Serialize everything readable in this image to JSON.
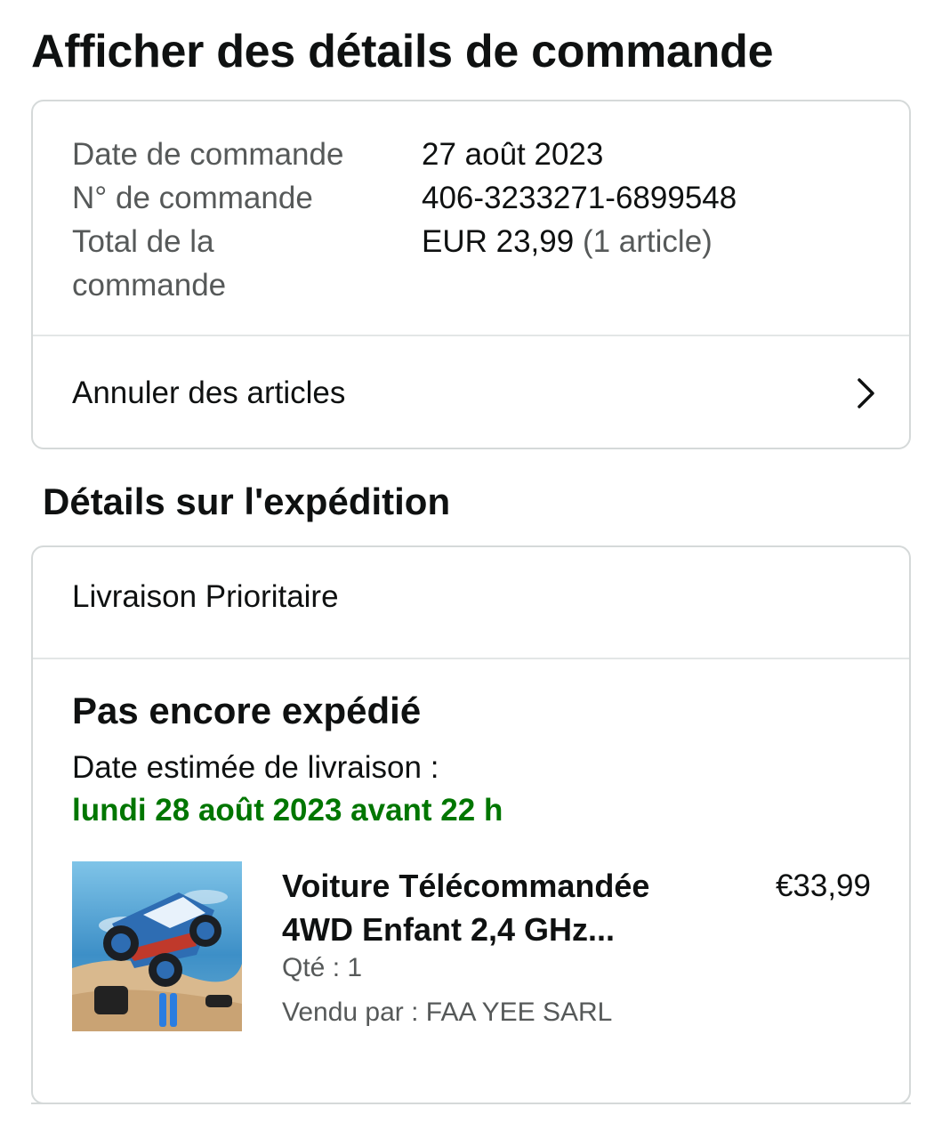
{
  "page_title": "Afficher des détails de commande",
  "order_summary": {
    "rows": [
      {
        "label": "Date de commande",
        "value": "27 août 2023"
      },
      {
        "label": "N° de commande",
        "value": "406-3233271-6899548"
      },
      {
        "label": "Total de la commande",
        "value": "EUR 23,99",
        "value_suffix": "(1 article)"
      }
    ],
    "cancel_link": "Annuler des articles"
  },
  "shipping": {
    "section_title": "Détails sur l'expédition",
    "method": "Livraison Prioritaire",
    "status": "Pas encore expédié",
    "estimate_label": "Date estimée de livraison :",
    "estimate_date": "lundi 28 août 2023 avant 22 h"
  },
  "product": {
    "title_line1": "Voiture Télécommandée",
    "title_line2": "4WD Enfant 2,4 GHz...",
    "price": "€33,99",
    "qty": "Qté : 1",
    "seller": "Vendu par : FAA YEE SARL"
  },
  "colors": {
    "estimate_green": "#007600",
    "muted_text": "#565959",
    "border": "#d5d9d9"
  }
}
